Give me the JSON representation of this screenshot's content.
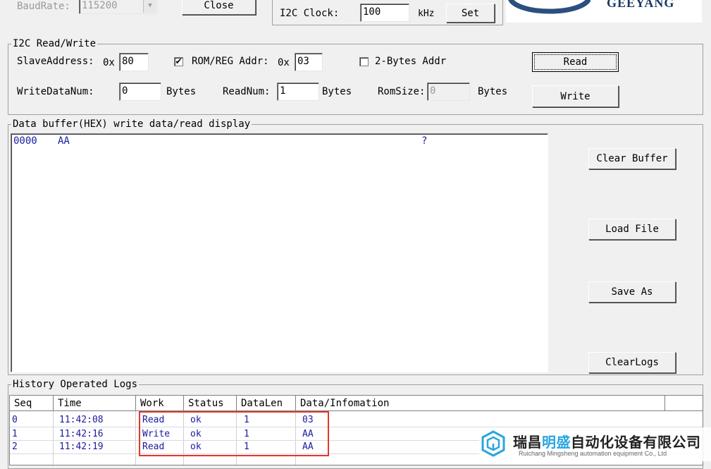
{
  "top": {
    "baudrate_label": "BaudRate:",
    "baudrate_value": "115200",
    "close_label": "Close",
    "i2c_clock_label": "I2C Clock:",
    "i2c_clock_value": "100",
    "i2c_clock_unit": "kHz",
    "set_label": "Set",
    "logo_text": "GEEYANG"
  },
  "rw": {
    "title": "I2C Read/Write",
    "slave_label": "SlaveAddress:",
    "slave_prefix": "0x",
    "slave_value": "80",
    "romreg_label": "ROM/REG Addr:",
    "romreg_prefix": "0x",
    "romreg_value": "03",
    "romreg_checked": "✔",
    "twobyte_label": "2-Bytes Addr",
    "read_label": "Read",
    "writenum_label": "WriteDataNum:",
    "writenum_value": "0",
    "bytes1": "Bytes",
    "readnum_label": "ReadNum:",
    "readnum_value": "1",
    "bytes2": "Bytes",
    "romsize_label": "RomSize:",
    "romsize_value": "0",
    "bytes3": "Bytes",
    "write_label": "Write"
  },
  "buffer": {
    "title": "Data buffer(HEX) write data/read display",
    "address": "0000",
    "data": "AA",
    "ascii": "?",
    "clear_buffer_label": "Clear Buffer",
    "load_file_label": "Load File",
    "save_as_label": "Save As",
    "clear_logs_label": "ClearLogs"
  },
  "logs": {
    "title": "History Operated Logs",
    "columns": [
      "Seq",
      "Time",
      "Work",
      "Status",
      "DataLen",
      "Data/Infomation"
    ],
    "rows": [
      [
        "0",
        "11:42:08",
        "Read",
        "ok",
        "1",
        "03"
      ],
      [
        "1",
        "11:42:16",
        "Write",
        "ok",
        "1",
        "AA"
      ],
      [
        "2",
        "11:42:19",
        "Read",
        "ok",
        "1",
        "AA"
      ]
    ]
  },
  "watermark": {
    "cn_part1": "瑞昌",
    "cn_accent": "明盛",
    "cn_part2": "自动化设备有限公司",
    "en": "Ruichang Mingsheng automation equipment Co., Ltd"
  },
  "colors": {
    "data_text": "#1a1aa0",
    "highlight": "#e0382a",
    "watermark_accent": "#2aa5e0"
  }
}
